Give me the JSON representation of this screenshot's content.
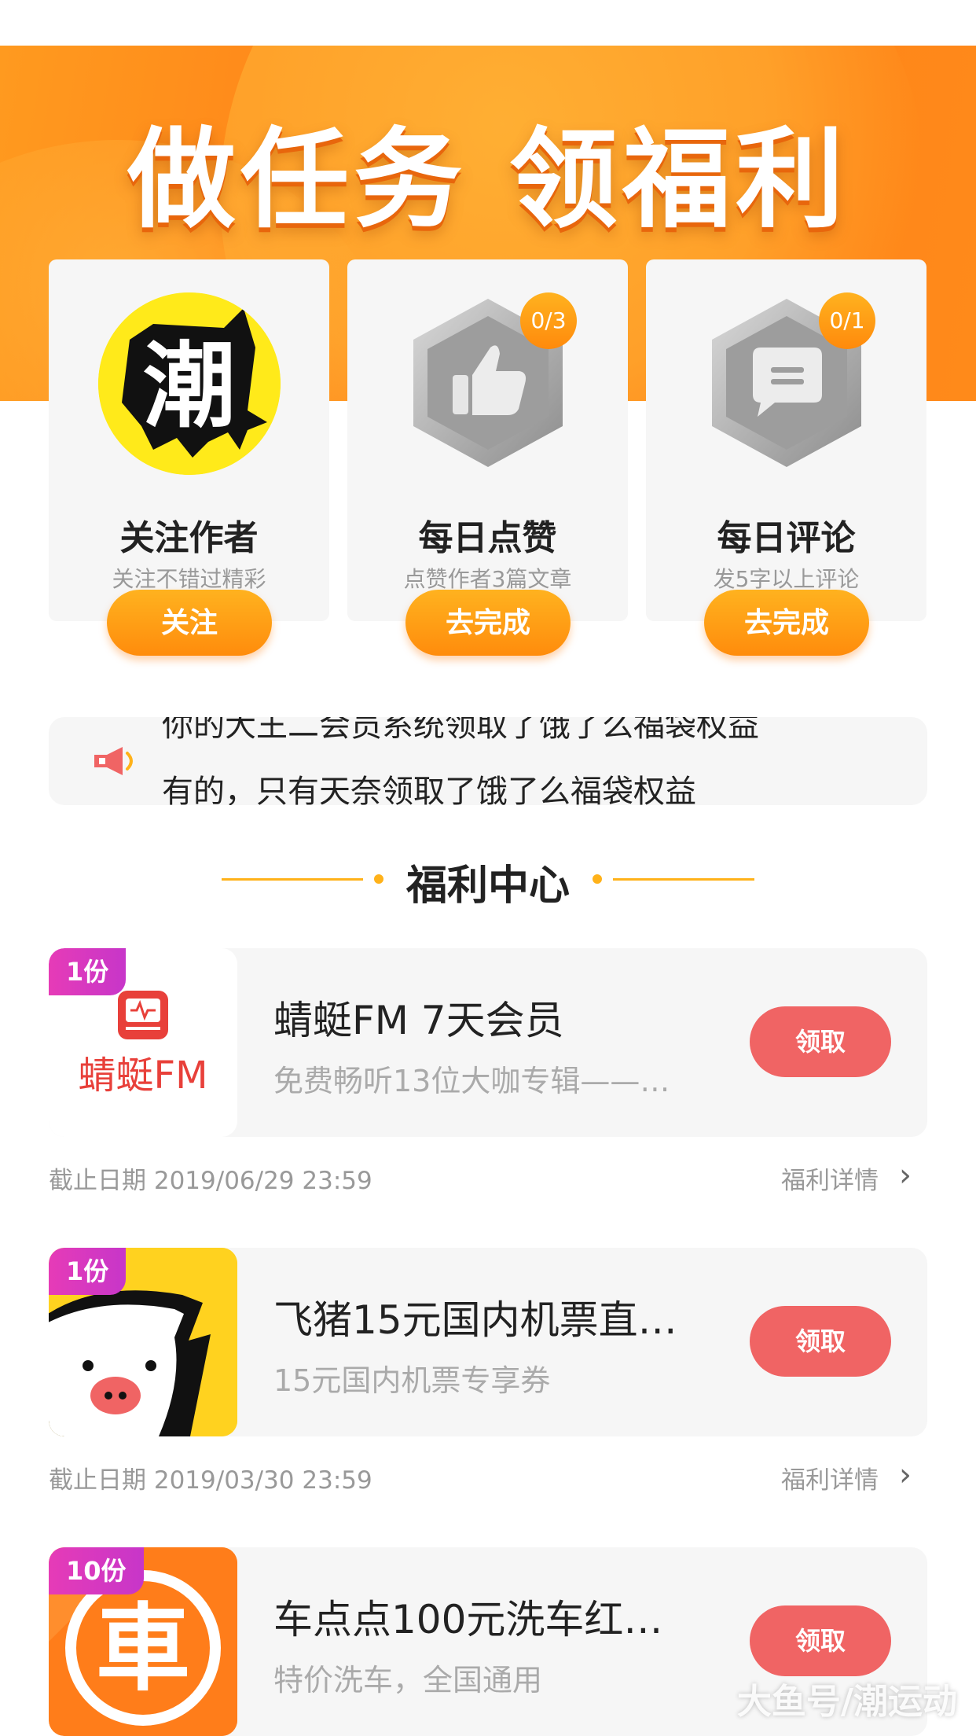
{
  "banner": {
    "title": "做任务 领福利"
  },
  "tasks": [
    {
      "title": "关注作者",
      "subtitle": "关注不错过精彩",
      "button": "关注",
      "avatar_text": "潮"
    },
    {
      "title": "每日点赞",
      "subtitle": "点赞作者3篇文章",
      "button": "去完成",
      "count": "0/3"
    },
    {
      "title": "每日评论",
      "subtitle": "发5字以上评论",
      "button": "去完成",
      "count": "0/1"
    }
  ],
  "notice": {
    "line1": "你的大王二会员系统领取了饿了么福袋权益",
    "line2": "有的，只有天奈领取了饿了么福袋权益"
  },
  "section": {
    "title": "福利中心"
  },
  "welfare": [
    {
      "qty": "1份",
      "title": "蜻蜓FM 7天会员",
      "subtitle": "免费畅听13位大咖专辑——…",
      "claim": "领取",
      "deadline": "截止日期 2019/06/29 23:59",
      "detail": "福利详情",
      "logo_text": "蜻蜓FM"
    },
    {
      "qty": "1份",
      "title": "飞猪15元国内机票直…",
      "subtitle": "15元国内机票专享券",
      "claim": "领取",
      "deadline": "截止日期 2019/03/30 23:59",
      "detail": "福利详情"
    },
    {
      "qty": "10份",
      "title": "车点点100元洗车红…",
      "subtitle": "特价洗车，全国通用",
      "claim": "领取",
      "logo_text": "車"
    }
  ],
  "watermark": "大鱼号/潮运动",
  "colors": {
    "accent": "#ff8c0c",
    "claim": "#f06464",
    "qty_badge": "#d93ac0"
  }
}
